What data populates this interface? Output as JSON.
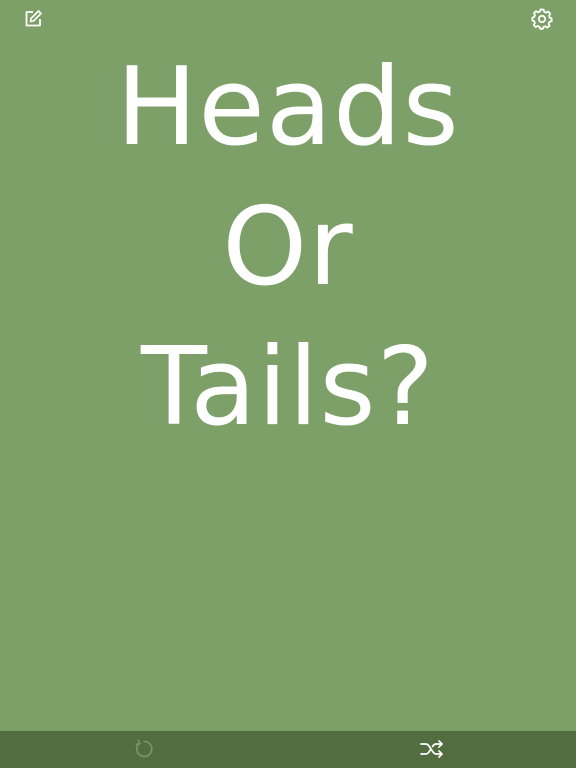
{
  "app": {
    "background_color": "#7da068",
    "bottom_bar_color": "#526d3f",
    "text_color": "#ffffff"
  },
  "header": {
    "left_icon": "edit-icon",
    "right_icon": "gear-icon"
  },
  "main": {
    "lines": [
      "Heads",
      "Or",
      "Tails?"
    ]
  },
  "toolbar": {
    "left_icon": "reset-icon",
    "right_icon": "shuffle-icon"
  }
}
